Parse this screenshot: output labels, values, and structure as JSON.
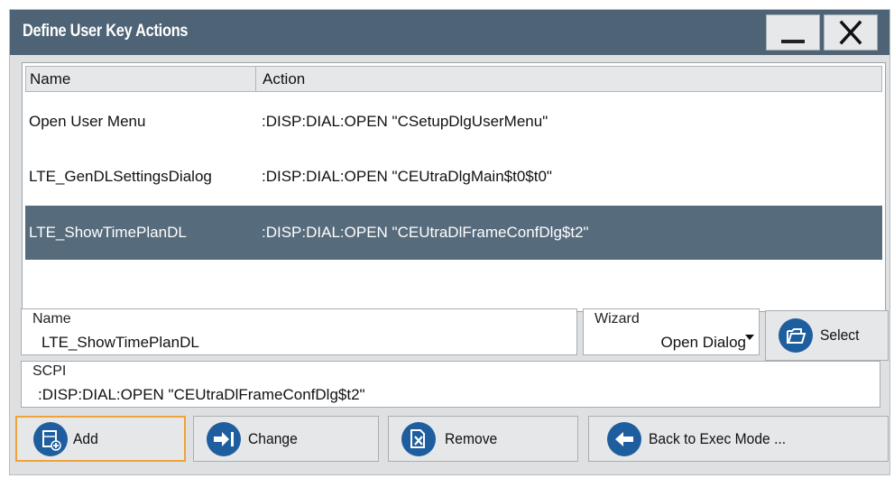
{
  "dialog": {
    "title": "Define User Key Actions"
  },
  "table": {
    "columns": {
      "name": "Name",
      "action": "Action"
    },
    "rows": [
      {
        "name": "Open User Menu",
        "action": ":DISP:DIAL:OPEN \"CSetupDlgUserMenu\""
      },
      {
        "name": "LTE_GenDLSettingsDialog",
        "action": ":DISP:DIAL:OPEN \"CEUtraDlgMain$t0$t0\""
      },
      {
        "name": "LTE_ShowTimePlanDL",
        "action": ":DISP:DIAL:OPEN \"CEUtraDlFrameConfDlg$t2\""
      }
    ],
    "selected_row": "LTE_ShowTimePlanDL"
  },
  "form": {
    "name_label": "Name",
    "name_value": "LTE_ShowTimePlanDL",
    "wizard_label": "Wizard",
    "wizard_value": "Open Dialog",
    "select_label": "Select",
    "scpi_label": "SCPI",
    "scpi_value": ":DISP:DIAL:OPEN \"CEUtraDlFrameConfDlg$t2\""
  },
  "buttons": {
    "add": "Add",
    "change": "Change",
    "remove": "Remove",
    "back": "Back to Exec Mode ..."
  },
  "icons": {
    "minimize": "minimize-icon",
    "close": "close-icon",
    "select": "folder-open-icon",
    "add": "add-document-icon",
    "change": "arrow-right-bar-icon",
    "remove": "delete-document-icon",
    "back": "arrow-left-icon"
  },
  "colors": {
    "titlebar": "#4e6476",
    "selected_row": "#566b7c",
    "icon_accent": "#1f5e9e",
    "focus_border": "#f0a23a"
  }
}
